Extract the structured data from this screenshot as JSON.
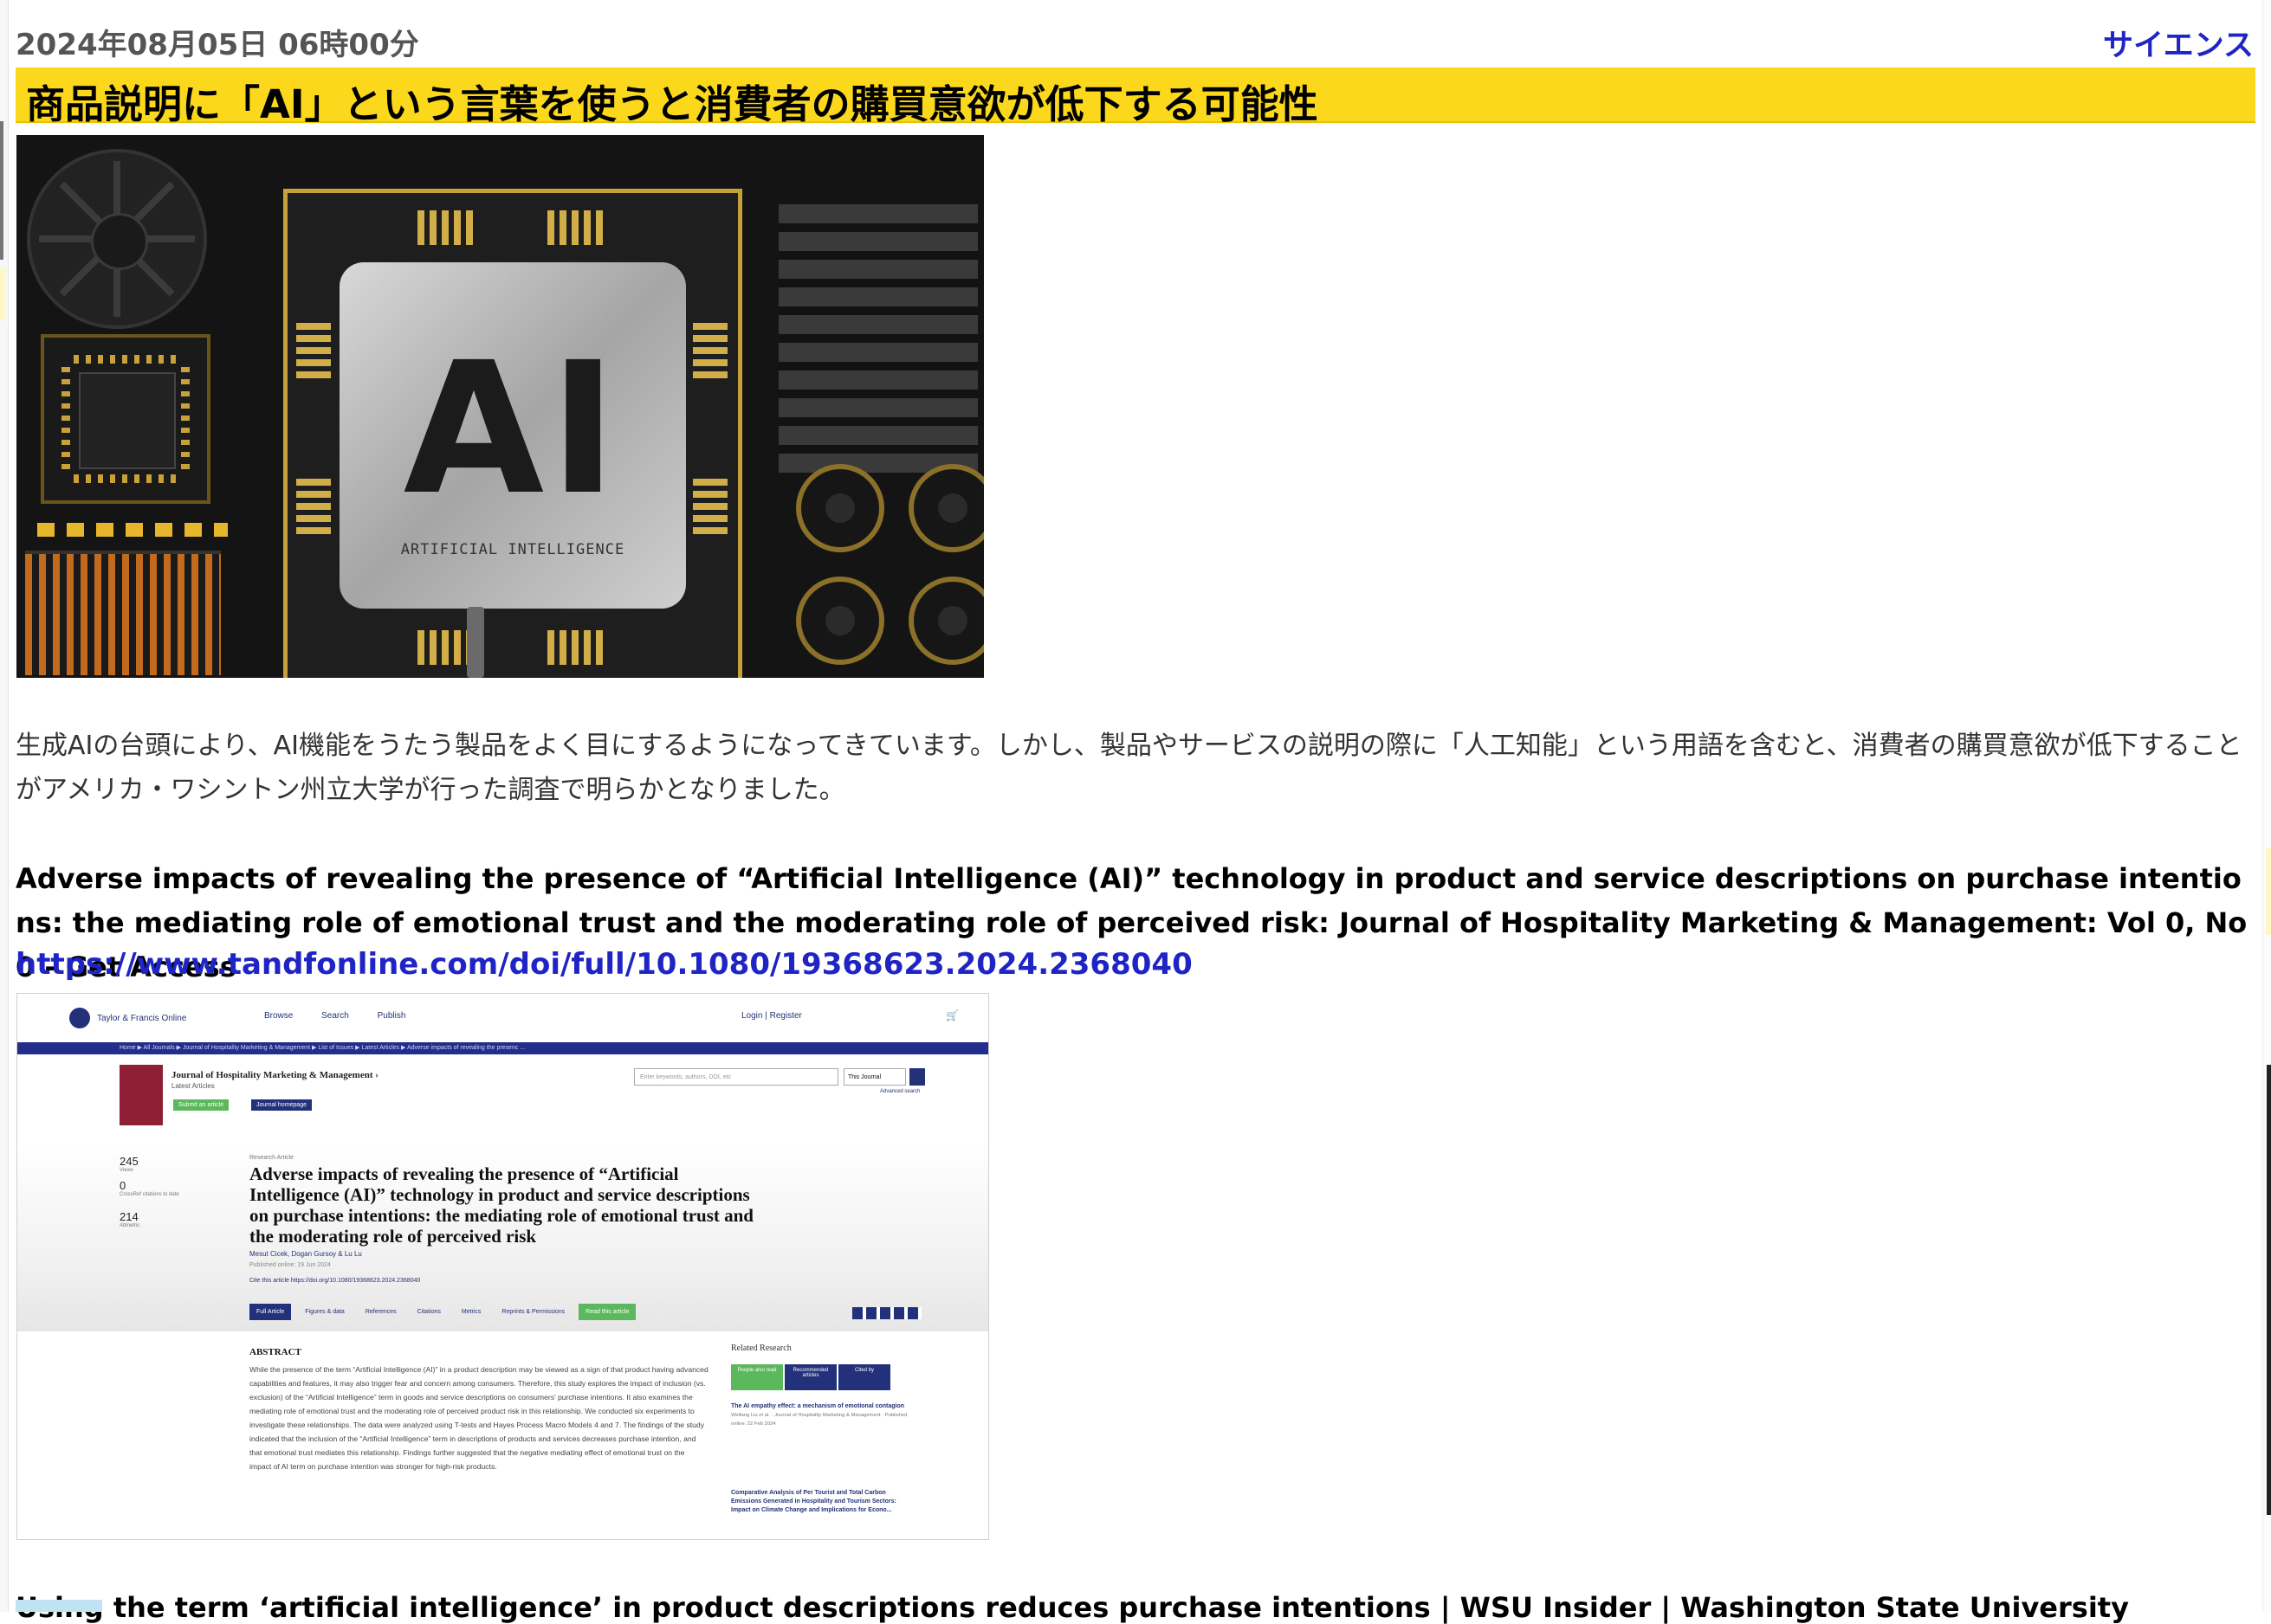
{
  "header": {
    "date": "2024年08月05日 06時00分",
    "category": "サイエンス"
  },
  "article": {
    "title": "商品説明に「AI」という言葉を使うと消費者の購買意欲が低下する可能性",
    "hero_text": "AI",
    "hero_subtext": "ARTIFICIAL INTELLIGENCE",
    "lead": "生成AIの台頭により、AI機能をうたう製品をよく目にするようになってきています。しかし、製品やサービスの説明の際に「人工知能」という用語を含むと、消費者の購買意欲が低下することがアメリカ・ワシントン州立大学が行った調査で明らかとなりました。"
  },
  "reference": {
    "title": "Adverse impacts of revealing the presence of “Artificial Intelligence (AI)” technology in product and service descriptions on purchase intentions: the mediating role of emotional trust and the moderating role of perceived risk: Journal of Hospitality Marketing & Management: Vol 0, No 0 - Get Access",
    "url": "https://www.tandfonline.com/doi/full/10.1080/19368623.2024.2368040"
  },
  "screenshot": {
    "logo": "Taylor & Francis Online",
    "nav": [
      "Browse",
      "Search",
      "Publish"
    ],
    "login": "Login | Register",
    "breadcrumb": "Home ▶ All Journals ▶ Journal of Hospitality Marketing & Management ▶ List of Issues ▶ Latest Articles ▶ Adverse impacts of revealing the presenc ...",
    "journal_name": "Journal of Hospitality Marketing & Management ›",
    "journal_sub": "Latest Articles",
    "submit_btn": "Submit an article",
    "homepage_btn": "Journal homepage",
    "search_placeholder": "Enter keywords, authors, DOI, etc",
    "search_scope": "This Journal",
    "advanced": "Advanced search",
    "metrics": [
      {
        "value": "245",
        "label": "Views"
      },
      {
        "value": "0",
        "label": "CrossRef citations to date"
      },
      {
        "value": "214",
        "label": "Altmetric"
      }
    ],
    "research_type": "Research Article",
    "article_title": "Adverse impacts of revealing the presence of “Artificial Intelligence (AI)” technology in product and service descriptions on purchase intentions: the mediating role of emotional trust and the moderating role of perceived risk",
    "authors": "Mesut Cicek, Dogan Gursoy & Lu Lu",
    "published": "Published online: 19 Jun 2024",
    "doi": "Cite this article   https://doi.org/10.1080/19368623.2024.2368040",
    "tabs": [
      "Full Article",
      "Figures & data",
      "References",
      "Citations",
      "Metrics",
      "Reprints & Permissions",
      "Read this article"
    ],
    "abstract_heading": "ABSTRACT",
    "abstract": "While the presence of the term “Artificial Intelligence (AI)” in a product description may be viewed as a sign of that product having advanced capabilities and features, it may also trigger fear and concern among consumers. Therefore, this study explores the impact of inclusion (vs. exclusion) of the “Artificial Intelligence” term in goods and service descriptions on consumers’ purchase intentions. It also examines the mediating role of emotional trust and the moderating role of perceived product risk in this relationship. We conducted six experiments to investigate these relationships. The data were analyzed using T-tests and Hayes Process Macro Models 4 and 7. The findings of the study indicated that the inclusion of the “Artificial Intelligence” term in descriptions of products and services decreases purchase intention, and that emotional trust mediates this relationship. Findings further suggested that the negative mediating effect of emotional trust on the impact of AI term on purchase intention was stronger for high-risk products.",
    "related_heading": "Related Research",
    "related_tabs": [
      "People also read",
      "Recommended articles",
      "Cited by"
    ],
    "related_items": [
      {
        "title": "The AI empathy effect: a mechanism of emotional contagion",
        "meta": "Weifang Liu et al. · Journal of Hospitality Marketing & Management · Published online: 22 Feb 2024"
      },
      {
        "title": "Comparative Analysis of Per Tourist and Total Carbon Emissions Generated in Hospitality and Tourism Sectors: Impact on Climate Change and Implications for Econo...",
        "meta": ""
      }
    ]
  },
  "next_link_partial": "Using the term ‘artificial intelligence’ in product descriptions reduces purchase intentions | WSU Insider | Washington State University"
}
